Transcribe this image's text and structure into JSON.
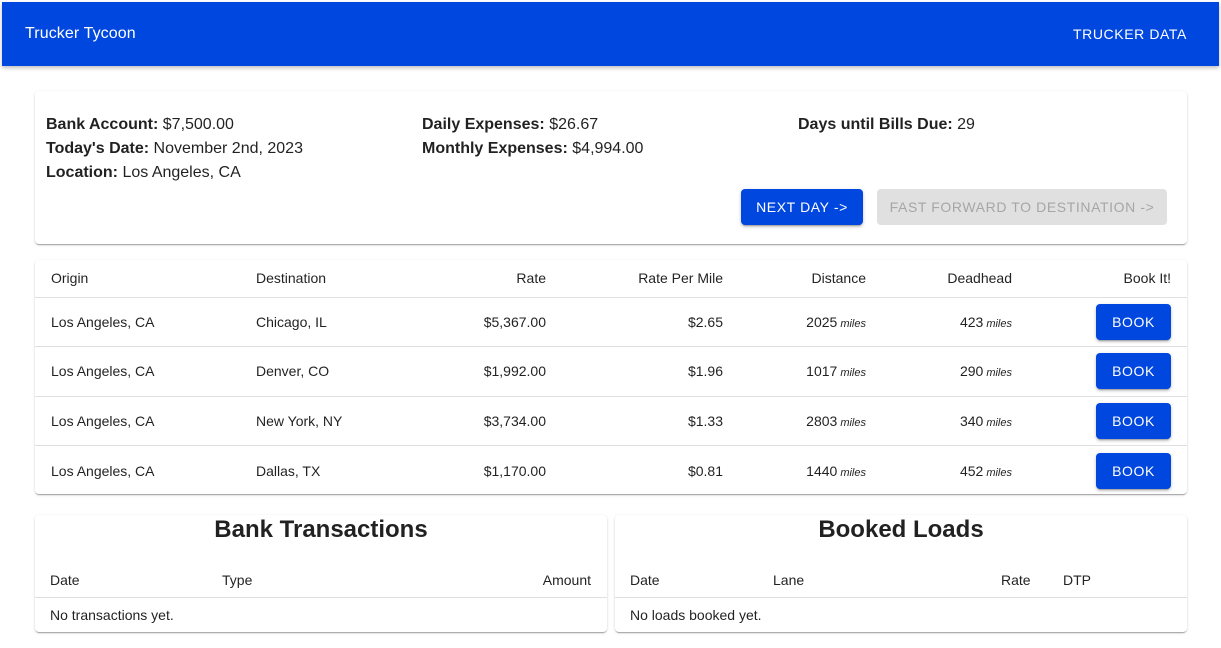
{
  "app": {
    "title": "Trucker Tycoon",
    "nav_label": "TRUCKER DATA"
  },
  "status": {
    "bank_label": "Bank Account:",
    "bank_value": "$7,500.00",
    "date_label": "Today's Date:",
    "date_value": "November 2nd, 2023",
    "location_label": "Location:",
    "location_value": "Los Angeles, CA",
    "daily_label": "Daily Expenses:",
    "daily_value": "$26.67",
    "monthly_label": "Monthly Expenses:",
    "monthly_value": "$4,994.00",
    "bills_label": "Days until Bills Due:",
    "bills_value": "29",
    "next_day_label": "NEXT DAY ->",
    "fast_forward_label": "FAST FORWARD TO DESTINATION ->"
  },
  "loads": {
    "headers": [
      "Origin",
      "Destination",
      "Rate",
      "Rate Per Mile",
      "Distance",
      "Deadhead",
      "Book It!"
    ],
    "unit": "miles",
    "book_label": "BOOK",
    "rows": [
      {
        "origin": "Los Angeles, CA",
        "destination": "Chicago, IL",
        "rate": "$5,367.00",
        "rpm": "$2.65",
        "distance": "2025",
        "deadhead": "423"
      },
      {
        "origin": "Los Angeles, CA",
        "destination": "Denver, CO",
        "rate": "$1,992.00",
        "rpm": "$1.96",
        "distance": "1017",
        "deadhead": "290"
      },
      {
        "origin": "Los Angeles, CA",
        "destination": "New York, NY",
        "rate": "$3,734.00",
        "rpm": "$1.33",
        "distance": "2803",
        "deadhead": "340"
      },
      {
        "origin": "Los Angeles, CA",
        "destination": "Dallas, TX",
        "rate": "$1,170.00",
        "rpm": "$0.81",
        "distance": "1440",
        "deadhead": "452"
      }
    ]
  },
  "bank": {
    "title": "Bank Transactions",
    "headers": [
      "Date",
      "Type",
      "Amount"
    ],
    "empty": "No transactions yet."
  },
  "booked": {
    "title": "Booked Loads",
    "headers": [
      "Date",
      "Lane",
      "Rate",
      "DTP"
    ],
    "empty": "No loads booked yet."
  },
  "colors": {
    "primary": "#0047E0",
    "disabled_bg": "#e0e0e0",
    "disabled_text": "#a6a6a6"
  }
}
